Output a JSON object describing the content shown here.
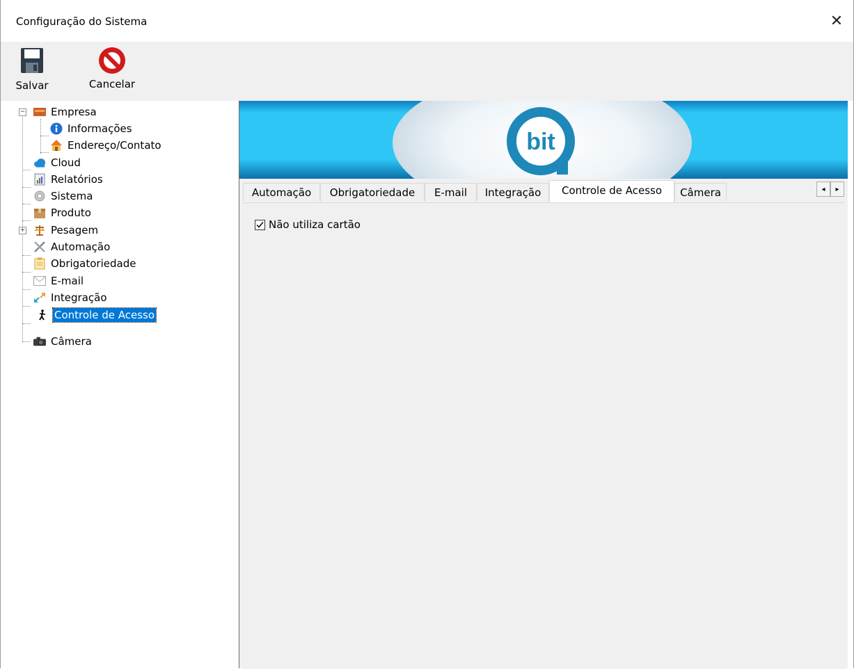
{
  "window": {
    "title": "Configuração do Sistema",
    "close_glyph": "✕"
  },
  "toolbar": {
    "save_label": "Salvar",
    "cancel_label": "Cancelar",
    "save_icon": "floppy-disk-icon",
    "cancel_icon": "prohibited-icon"
  },
  "tree": {
    "items": [
      {
        "label": "Empresa",
        "icon": "company-icon",
        "expander": "−"
      },
      {
        "label": "Informações",
        "icon": "info-icon"
      },
      {
        "label": "Endereço/Contato",
        "icon": "house-icon"
      },
      {
        "label": "Cloud",
        "icon": "cloud-icon"
      },
      {
        "label": "Relatórios",
        "icon": "report-icon"
      },
      {
        "label": "Sistema",
        "icon": "gear-icon"
      },
      {
        "label": "Produto",
        "icon": "box-icon"
      },
      {
        "label": "Pesagem",
        "icon": "scale-icon",
        "expander": "+"
      },
      {
        "label": "Automação",
        "icon": "tools-icon"
      },
      {
        "label": "Obrigatoriedade",
        "icon": "clipboard-icon"
      },
      {
        "label": "E-mail",
        "icon": "envelope-icon"
      },
      {
        "label": "Integração",
        "icon": "arrows-icon"
      },
      {
        "label": "Controle de Acesso",
        "icon": "walking-person-icon",
        "selected": true
      },
      {
        "label": "Câmera",
        "icon": "camera-icon"
      }
    ]
  },
  "banner": {
    "logo_text": "bit",
    "colors": {
      "accent": "#2ec6f5",
      "dark": "#0c6fa8",
      "logo": "#1e88b8"
    }
  },
  "tabs": [
    {
      "label": "Automação"
    },
    {
      "label": "Obrigatoriedade"
    },
    {
      "label": "E-mail"
    },
    {
      "label": "Integração"
    },
    {
      "label": "Controle de Acesso",
      "active": true
    },
    {
      "label": "Câmera"
    }
  ],
  "tab_scroll": {
    "left": "◂",
    "right": "▸"
  },
  "access_control": {
    "no_card_label": "Não utiliza cartão",
    "no_card_checked": true
  },
  "colors": {
    "selection": "#0078d7",
    "toolbar_bg": "#f0f0f0"
  }
}
